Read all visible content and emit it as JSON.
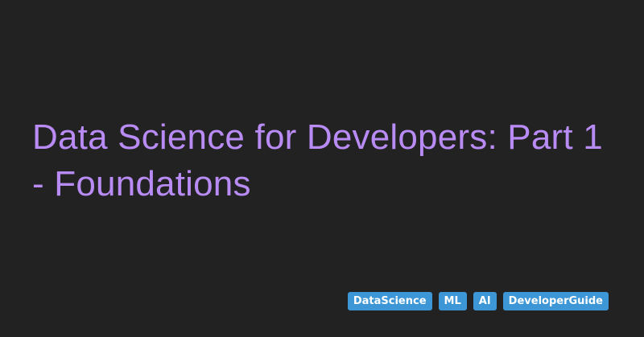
{
  "card": {
    "title": "Data Science for Developers: Part 1 - Foundations",
    "tags": [
      "DataScience",
      "ML",
      "AI",
      "DeveloperGuide"
    ]
  },
  "colors": {
    "background": "#222222",
    "title": "#b98cf5",
    "tag_background": "#3d96d6",
    "tag_text": "#ffffff"
  }
}
